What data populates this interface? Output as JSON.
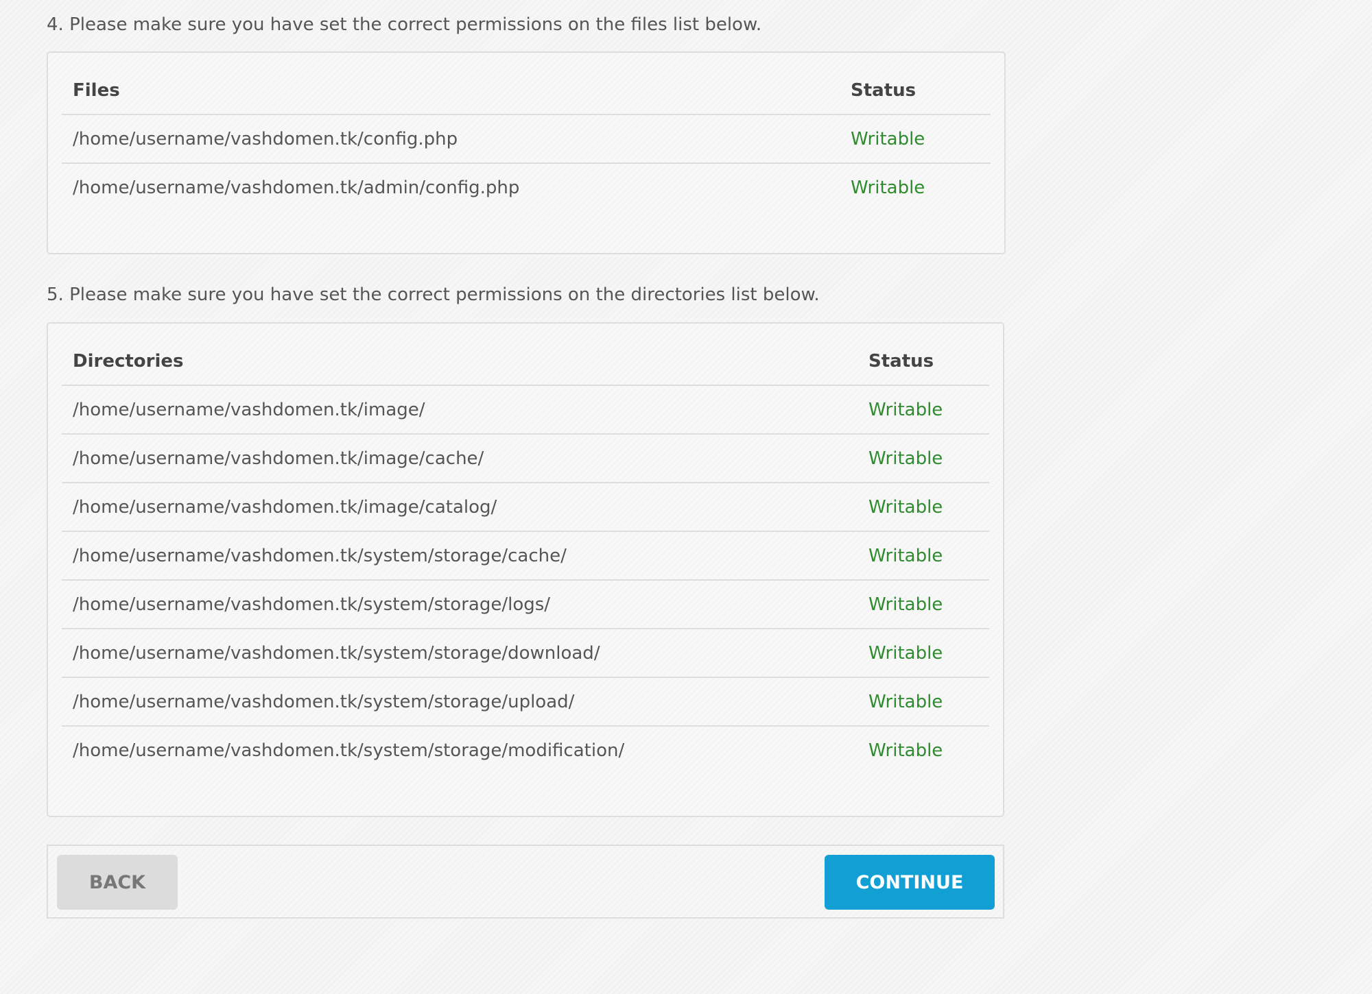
{
  "step4": {
    "text": "4. Please make sure you have set the correct permissions on the files list below.",
    "headers": {
      "name": "Files",
      "status": "Status"
    },
    "rows": [
      {
        "path": "/home/username/vashdomen.tk/config.php",
        "status": "Writable"
      },
      {
        "path": "/home/username/vashdomen.tk/admin/config.php",
        "status": "Writable"
      }
    ]
  },
  "step5": {
    "text": "5. Please make sure you have set the correct permissions on the directories list below.",
    "headers": {
      "name": "Directories",
      "status": "Status"
    },
    "rows": [
      {
        "path": "/home/username/vashdomen.tk/image/",
        "status": "Writable"
      },
      {
        "path": "/home/username/vashdomen.tk/image/cache/",
        "status": "Writable"
      },
      {
        "path": "/home/username/vashdomen.tk/image/catalog/",
        "status": "Writable"
      },
      {
        "path": "/home/username/vashdomen.tk/system/storage/cache/",
        "status": "Writable"
      },
      {
        "path": "/home/username/vashdomen.tk/system/storage/logs/",
        "status": "Writable"
      },
      {
        "path": "/home/username/vashdomen.tk/system/storage/download/",
        "status": "Writable"
      },
      {
        "path": "/home/username/vashdomen.tk/system/storage/upload/",
        "status": "Writable"
      },
      {
        "path": "/home/username/vashdomen.tk/system/storage/modification/",
        "status": "Writable"
      }
    ]
  },
  "buttons": {
    "back": "BACK",
    "continue": "CONTINUE"
  },
  "colors": {
    "writable": "#2e8b2e",
    "primary": "#12a0d4"
  }
}
